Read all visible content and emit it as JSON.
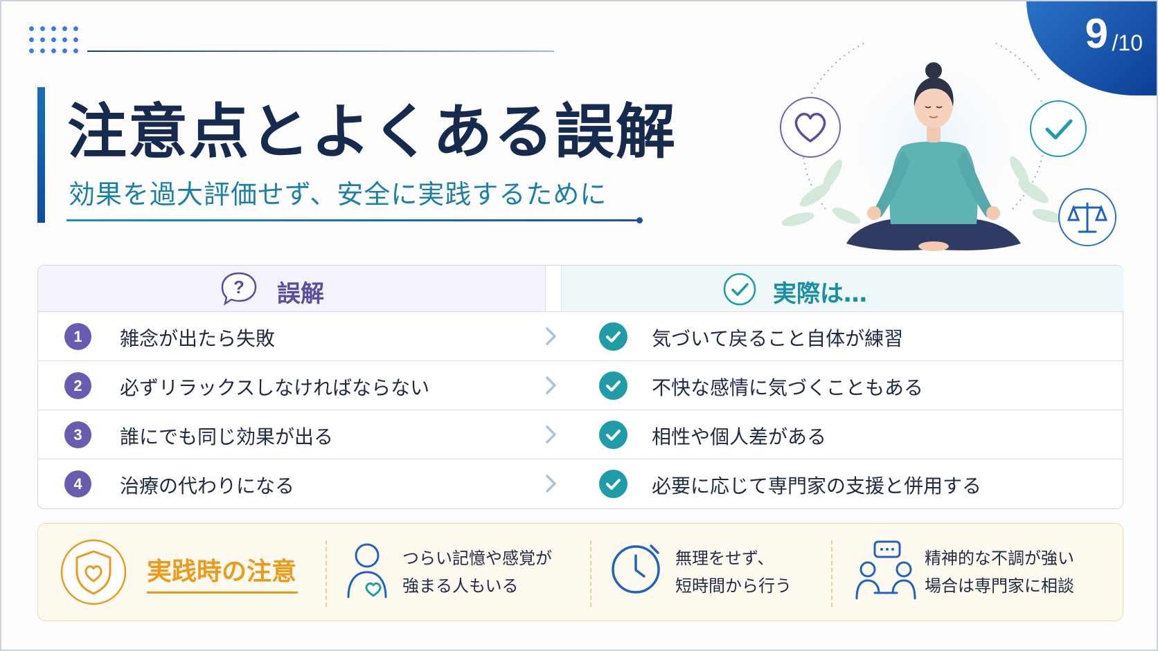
{
  "page": {
    "current": "9",
    "total": "/10"
  },
  "title": "注意点とよくある誤解",
  "subtitle": "効果を過大評価せず、安全に実践するために",
  "illustration": {
    "icons": [
      "heart-icon",
      "check-icon",
      "balance-scale-icon",
      "meditation-figure"
    ]
  },
  "table": {
    "myth_header": "誤解",
    "fact_header": "実際は…",
    "rows": [
      {
        "num": "1",
        "myth": "雑念が出たら失敗",
        "fact": "気づいて戻ること自体が練習"
      },
      {
        "num": "2",
        "myth": "必ずリラックスしなければならない",
        "fact": "不快な感情に気づくこともある"
      },
      {
        "num": "3",
        "myth": "誰にでも同じ効果が出る",
        "fact": "相性や個人差がある"
      },
      {
        "num": "4",
        "myth": "治療の代わりになる",
        "fact": "必要に応じて専門家の支援と併用する"
      }
    ]
  },
  "caution": {
    "title": "実践時の注意",
    "items": [
      {
        "icon": "person-heart-icon",
        "line1": "つらい記憶や感覚が",
        "line2": "強まる人もいる"
      },
      {
        "icon": "clock-icon",
        "line1": "無理をせず、",
        "line2": "短時間から行う"
      },
      {
        "icon": "consultation-icon",
        "line1": "精神的な不調が強い",
        "line2": "場合は専門家に相談"
      }
    ]
  },
  "colors": {
    "navy": "#152a4d",
    "teal": "#1b7fa9",
    "purple": "#6a5bb1",
    "check_teal": "#1f9ca5",
    "orange": "#eb9a1c"
  }
}
